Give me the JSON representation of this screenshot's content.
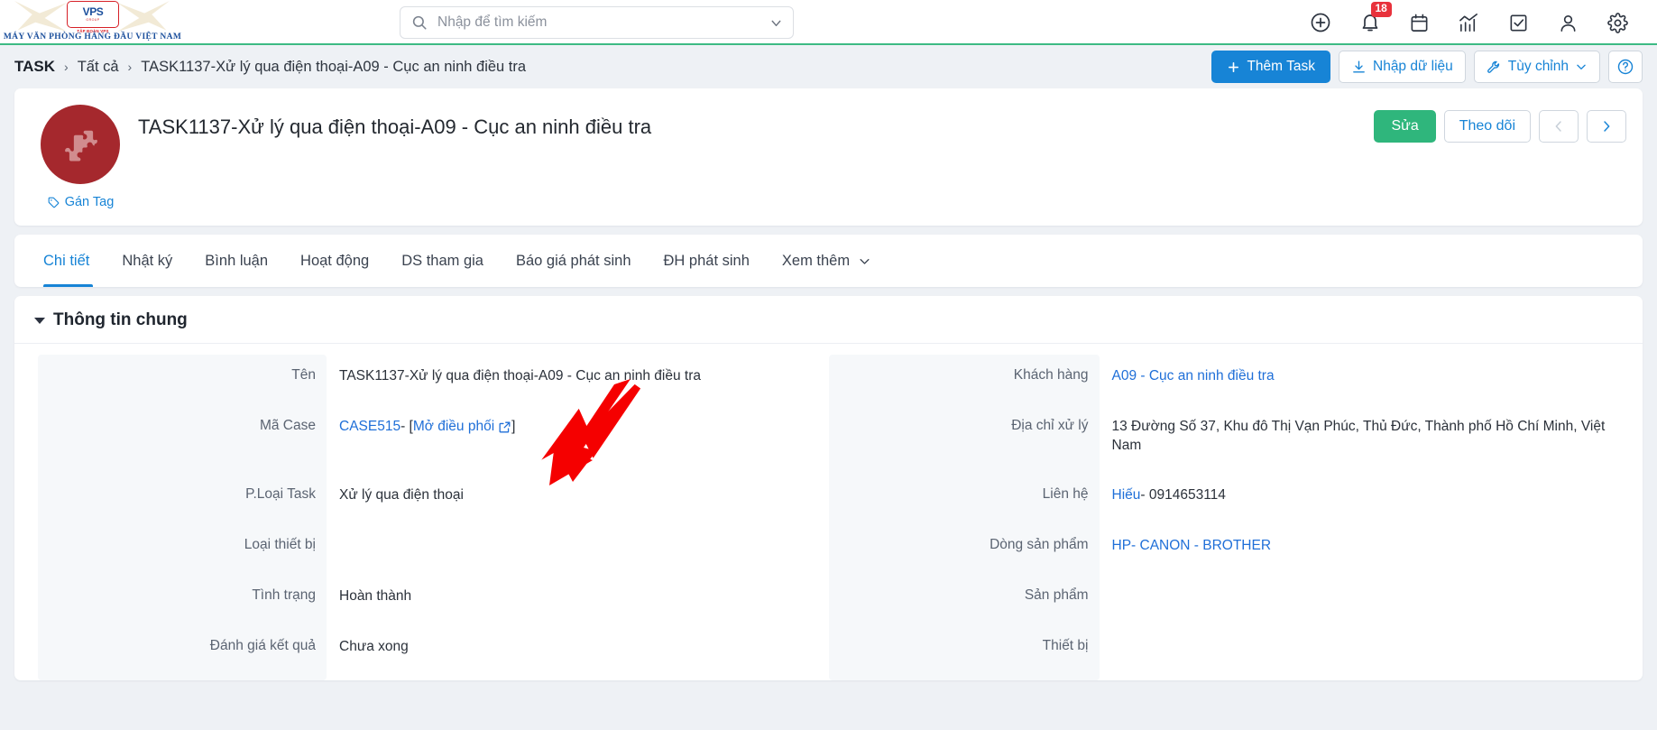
{
  "brand": {
    "badge_text": "VPS",
    "badge_sub": "GROUP",
    "badge_caption": "TẬP ĐOÀN VPS",
    "tagline": "MÁY VĂN PHÒNG HÀNG ĐẦU VIỆT NAM"
  },
  "search": {
    "placeholder": "Nhập để tìm kiếm",
    "value": ""
  },
  "topbar": {
    "icons": [
      {
        "name": "add-circle-icon",
        "label": "Thêm"
      },
      {
        "name": "bell-icon",
        "label": "Thông báo",
        "badge": "18"
      },
      {
        "name": "calendar-icon",
        "label": "Lịch"
      },
      {
        "name": "chart-icon",
        "label": "Báo cáo"
      },
      {
        "name": "checkbox-icon",
        "label": "Công việc"
      },
      {
        "name": "user-icon",
        "label": "Tài khoản"
      },
      {
        "name": "gear-icon",
        "label": "Cài đặt"
      }
    ],
    "notification_count": "18"
  },
  "breadcrumb": {
    "root": "TASK",
    "separator": "›",
    "level2": "Tất cả",
    "level3": "TASK1137-Xử lý qua điện thoại-A09 - Cục an ninh điều tra"
  },
  "toolbar": {
    "add_task": "Thêm Task",
    "import_data": "Nhập dữ liệu",
    "customize": "Tùy chỉnh",
    "help": "?"
  },
  "record": {
    "title": "TASK1137-Xử lý qua điện thoại-A09 - Cục an ninh điều tra",
    "tag_label": "Gán Tag",
    "edit_label": "Sửa",
    "follow_label": "Theo dõi",
    "prev_label": "‹",
    "next_label": "›"
  },
  "tabs": [
    {
      "label": "Chi tiết",
      "active": true
    },
    {
      "label": "Nhật ký",
      "active": false
    },
    {
      "label": "Bình luận",
      "active": false
    },
    {
      "label": "Hoạt động",
      "active": false
    },
    {
      "label": "DS tham gia",
      "active": false
    },
    {
      "label": "Báo giá phát sinh",
      "active": false
    },
    {
      "label": "ĐH phát sinh",
      "active": false
    },
    {
      "label": "Xem thêm",
      "active": false
    }
  ],
  "section": {
    "title": "Thông tin chung"
  },
  "fields_left": [
    {
      "label": "Tên",
      "value": "TASK1137-Xử lý qua điện thoại-A09 - Cục an ninh điều tra",
      "link": false
    },
    {
      "label": "Mã Case",
      "value": "CASE515",
      "link": true,
      "suffix_open": " - [ ",
      "suffix_link": "Mở điều phối",
      "suffix_close": "]"
    },
    {
      "label": "P.Loại Task",
      "value": "Xử lý qua điện thoại",
      "link": false
    },
    {
      "label": "Loại thiết bị",
      "value": "",
      "link": false
    },
    {
      "label": "Tình trạng",
      "value": "Hoàn thành",
      "link": false
    },
    {
      "label": "Đánh giá kết quả",
      "value": "Chưa xong",
      "link": false
    }
  ],
  "fields_right": [
    {
      "label": "Khách hàng",
      "value": "A09 - Cục an ninh điều tra",
      "link": true
    },
    {
      "label": "Địa chỉ xử lý",
      "value": "13 Đường Số 37, Khu đô Thị Vạn Phúc, Thủ Đức, Thành phố Hồ Chí Minh, Việt Nam",
      "link": false
    },
    {
      "label": "Liên hệ",
      "value": "Hiếu",
      "link": true,
      "suffix_plain": " - 0914653114"
    },
    {
      "label": "Dòng sản phẩm",
      "value": "HP- CANON - BROTHER",
      "link": true
    },
    {
      "label": "Sản phẩm",
      "value": "",
      "link": false
    },
    {
      "label": "Thiết bị",
      "value": "",
      "link": false
    }
  ],
  "colors": {
    "accent_blue": "#1784d6",
    "link_blue": "#1f6fd8",
    "green": "#2fb67c",
    "header_rule_green": "#3dba84",
    "badge_red": "#e8323c",
    "avatar_red": "#a5282d",
    "annotation_red": "#f50000"
  }
}
